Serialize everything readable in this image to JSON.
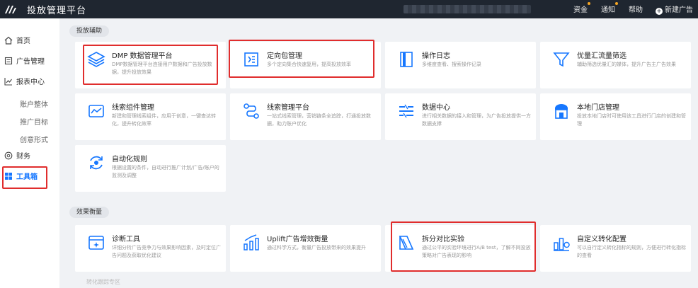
{
  "header": {
    "app_title": "投放管理平台",
    "nav": [
      "资金",
      "通知",
      "帮助"
    ],
    "new_button": "新建广告"
  },
  "sidebar": {
    "items": [
      {
        "label": "首页",
        "icon": "home-icon"
      },
      {
        "label": "广告管理",
        "icon": "ad-list-icon"
      },
      {
        "label": "报表中心",
        "icon": "chart-line-icon"
      },
      {
        "label": "账户整体"
      },
      {
        "label": "推广目标"
      },
      {
        "label": "创意形式"
      },
      {
        "label": "财务",
        "icon": "finance-icon"
      },
      {
        "label": "工具箱",
        "icon": "toolbox-icon"
      }
    ]
  },
  "sections": [
    {
      "label": "投放辅助",
      "cards": [
        {
          "title": "DMP 数据管理平台",
          "desc": "DMP数据管理平台连接用户数据和广告投放数据，提升投放效果",
          "icon": "layers-icon"
        },
        {
          "title": "定向包管理",
          "desc": "多个定向集合快速复用，提高投放效率",
          "icon": "target-package-icon"
        },
        {
          "title": "操作日志",
          "desc": "多维度查看、搜索操作记录",
          "icon": "log-book-icon"
        },
        {
          "title": "优量汇流量筛选",
          "desc": "辅助筛选优量汇的媒体，提升广告主广告效果",
          "icon": "funnel-icon"
        },
        {
          "title": "线索组件管理",
          "desc": "新建和管理线索组件，应用于创意，一键查达转化，提升转化效率",
          "icon": "lead-component-icon"
        },
        {
          "title": "线索管理平台",
          "desc": "一站式线索管理，营销链条全追踪，打通投放数据，助力账户优化",
          "icon": "lead-flow-icon"
        },
        {
          "title": "数据中心",
          "desc": "进行相关数据的接入和管理，为广告投放提供一方数据支撑",
          "icon": "data-center-icon"
        },
        {
          "title": "本地门店管理",
          "desc": "投放本地门店时可使用该工具进行门店的创建和管理",
          "icon": "store-icon"
        },
        {
          "title": "自动化规则",
          "desc": "根据设置的条件，自动进行推广计划/广告/账户的监测及调整",
          "icon": "automation-icon"
        }
      ]
    },
    {
      "label": "效果衡量",
      "cards": [
        {
          "title": "诊断工具",
          "desc": "详细分析广告竞争力与效果影响因素，及时定位广告问题及获取优化建议",
          "icon": "diagnose-icon"
        },
        {
          "title": "Uplift广告增效衡量",
          "desc": "通过科学方式，衡量广告投放带来的效果提升",
          "icon": "uplift-chart-icon"
        },
        {
          "title": "拆分对比实验",
          "desc": "通过公平的实验环境进行A/B test，了解不同投放策略对广告表现的影响",
          "icon": "split-test-icon"
        },
        {
          "title": "自定义转化配置",
          "desc": "可以自行定义转化指标的规则，方便进行转化指标的查看",
          "icon": "custom-conversion-icon"
        }
      ]
    }
  ],
  "footer_section": "转化跟踪专区",
  "colors": {
    "accent": "#1677ff",
    "topbar": "#1f2630",
    "highlight": "#e02d2d"
  }
}
